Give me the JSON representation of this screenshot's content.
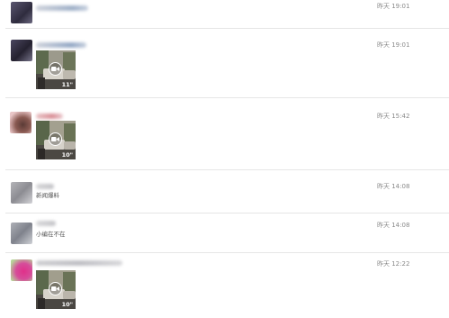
{
  "messages": [
    {
      "time": "昨天 19:01"
    },
    {
      "time": "昨天 19:01",
      "video_duration": "11\""
    },
    {
      "time": "昨天 15:42",
      "video_duration": "10\""
    },
    {
      "time": "昨天 14:08",
      "text": "新闻爆料"
    },
    {
      "time": "昨天 14:08",
      "text": "小编在不在"
    },
    {
      "time": "昨天 12:22",
      "video_duration": "10\""
    }
  ],
  "colors": {
    "separator": "#e6e6e6",
    "time_text": "#8a8a8a",
    "avatar_pink": "#e0308a"
  },
  "icons": {
    "video_badge": "video-camera-icon"
  }
}
